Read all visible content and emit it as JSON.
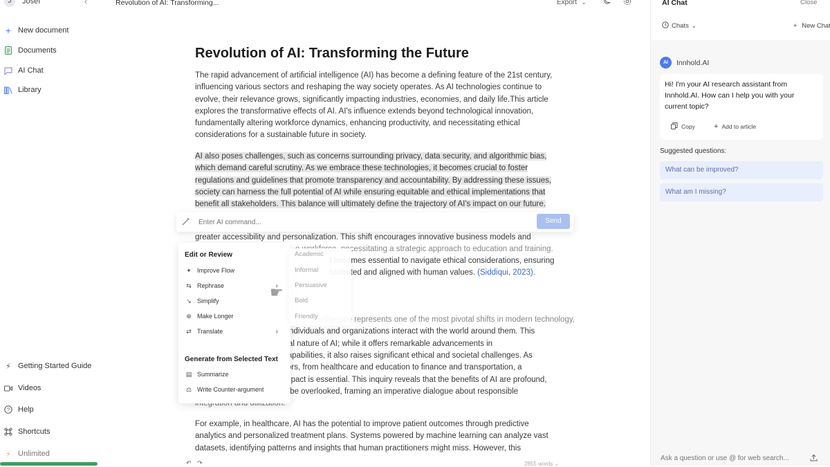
{
  "sidebar": {
    "user": {
      "initial": "J",
      "name": "Josef"
    },
    "collapse_icon": "chevron-left-icon",
    "items": [
      {
        "label": "New document",
        "icon": "plus-icon"
      },
      {
        "label": "Documents",
        "icon": "document-icon"
      },
      {
        "label": "AI Chat",
        "icon": "chat-icon"
      },
      {
        "label": "Library",
        "icon": "library-icon"
      }
    ],
    "footer_items": [
      {
        "label": "Getting Started Guide",
        "icon": "lightning-icon"
      },
      {
        "label": "Videos",
        "icon": "video-icon"
      },
      {
        "label": "Help",
        "icon": "help-icon"
      },
      {
        "label": "Shortcuts",
        "icon": "keyboard-icon"
      },
      {
        "label": "Unlimited",
        "icon": "bolt-icon"
      }
    ],
    "plan_progress": 1.0,
    "plan_color": "#3f9d5a"
  },
  "editor": {
    "doc_title": "Revolution of AI: Transforming...",
    "export_label": "Export",
    "heading": "Revolution of AI: Transforming the Future",
    "paragraph1": "The rapid advancement of artificial intelligence (AI) has become a defining feature of the 21st century, influencing various sectors and reshaping the way society operates. As AI technologies continue to evolve, their relevance grows, significantly impacting industries, economies, and daily life.This article explores the transformative effects of AI. AI's influence extends beyond technological innovation, fundamentally altering workforce dynamics, enhancing productivity, and necessitating ethical considerations for a sustainable future in society.",
    "paragraph2": "AI also poses challenges, such as concerns surrounding privacy, data security, and algorithmic bias, which demand careful scrutiny. As we embrace these technologies, it becomes crucial to foster regulations and guidelines that promote transparency and accountability. By addressing these issues, society can harness the full potential of AI while ensuring equitable and ethical implementations that benefit all stakeholders. This balance will ultimately define the trajectory of AI's impact on our future.",
    "paragraph3_line1": "greater accessibility and personalization. This shift encourages innovative business models and",
    "paragraph3_line2": "e workforce, necessitating a strategic approach to education and training.",
    "paragraph3_line3": "t becomes essential to navigate ethical considerations, ensuring",
    "paragraph3_line4": "istributed and aligned with human values.",
    "citation": "(Siddiqui, 2023).",
    "paragraph4_lines": [
      "ntelligence represents one of the most pivotal shifts in modern technology,",
      "ndividuals and organizations interact with the world around them. This",
      "the dual nature of AI; while it offers remarkable advancements in",
      "ng capabilities, it also raises significant ethical and societal challenges. As",
      "s sectors, from healthcare and education to finance and transportation, a",
      "mpact is essential. This inquiry reveals that the benefits of AI are profound,",
      "not be overlooked, framing an imperative dialogue about responsible",
      "integration and utilization."
    ],
    "paragraph5": "For example, in healthcare, AI has the potential to improve patient outcomes through predictive analytics and personalized treatment plans. Systems powered by machine learning can analyze vast datasets, identifying patterns and insights that human practitioners might miss. However, this",
    "word_count": "2855 words"
  },
  "ai_command": {
    "placeholder": "Enter AI command...",
    "send_label": "Send"
  },
  "menu": {
    "section1": "Edit or Review",
    "items1": [
      {
        "label": "Improve Flow",
        "icon": "wand-icon"
      },
      {
        "label": "Rephrase",
        "icon": "arrows-swap-icon"
      },
      {
        "label": "Simplify",
        "icon": "compress-icon"
      },
      {
        "label": "Make Longer",
        "icon": "plus-circle-icon"
      },
      {
        "label": "Translate",
        "icon": "translate-icon"
      }
    ],
    "section2": "Generate from Selected Text",
    "items2": [
      {
        "label": "Summarize",
        "icon": "document-icon"
      },
      {
        "label": "Write Counter-argument",
        "icon": "scale-icon"
      }
    ],
    "submenu": [
      "Academic",
      "Informal",
      "Persuasive",
      "Bold",
      "Friendly"
    ]
  },
  "chat": {
    "title": "AI Chat",
    "close_label": "Close",
    "chats_label": "Chats",
    "new_chat_label": "New Chat",
    "bot_name": "Innhold.AI",
    "bot_avatar": "AI",
    "message": "Hi! I'm your AI research assistant from Innhold.AI. How can I help you with your current topic?",
    "copy_label": "Copy",
    "add_label": "Add to article",
    "suggested_title": "Suggested questions:",
    "suggestions": [
      "What can be improved?",
      "What am I missing?"
    ],
    "input_placeholder": "Ask a question or use @ for web search..."
  }
}
